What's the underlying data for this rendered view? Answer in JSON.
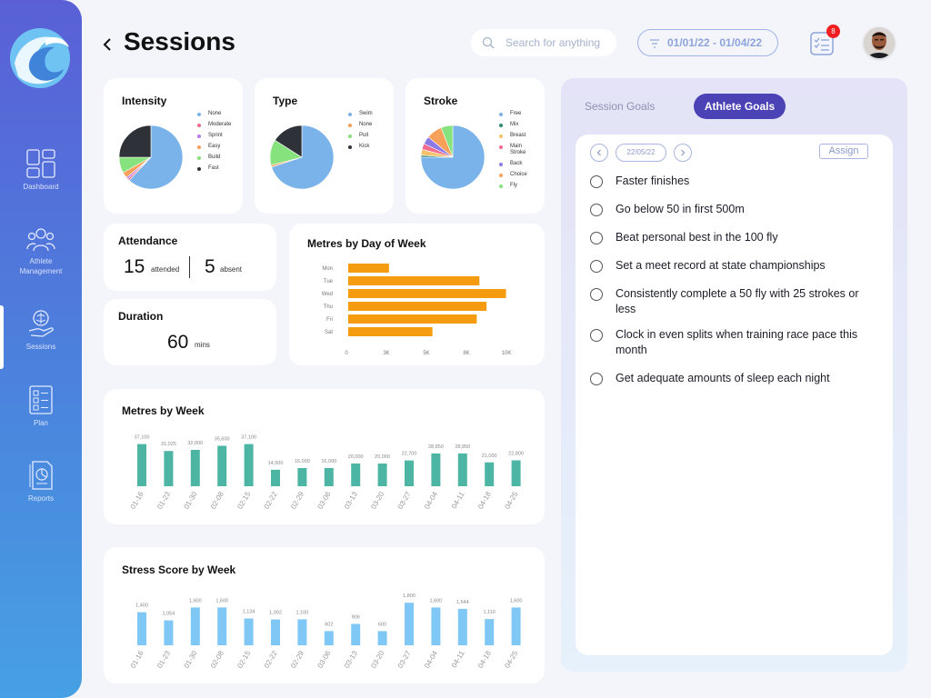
{
  "header": {
    "title": "Sessions",
    "search_placeholder": "Search for anything",
    "date_range": "01/01/22 - 01/04/22",
    "notification_count": "8"
  },
  "sidebar": {
    "items": [
      {
        "label": "Dashboard",
        "icon": "dashboard-icon"
      },
      {
        "label": "Athlete\nManagement",
        "icon": "athletes-icon"
      },
      {
        "label": "Sessions",
        "icon": "sessions-icon",
        "active": true
      },
      {
        "label": "Plan",
        "icon": "plan-icon"
      },
      {
        "label": "Reports",
        "icon": "reports-icon"
      }
    ]
  },
  "cards": {
    "intensity_title": "Intensity",
    "type_title": "Type",
    "stroke_title": "Stroke",
    "attendance_title": "Attendance",
    "attended_value": "15",
    "attended_label": "attended",
    "absent_value": "5",
    "absent_label": "absent",
    "duration_title": "Duration",
    "duration_value": "60",
    "duration_unit": "mins",
    "metres_day_title": "Metres by Day of Week",
    "metres_week_title": "Metres by Week",
    "stress_week_title": "Stress Score by Week"
  },
  "goals": {
    "tab_session": "Session Goals",
    "tab_athlete": "Athlete Goals",
    "date": "22/05/22",
    "assign_label": "Assign",
    "items": [
      "Faster finishes",
      "Go below 50 in first 500m",
      "Beat personal best in the 100 fly",
      "Set a meet record at state championships",
      "Consistently complete a 50 fly with 25 strokes or less",
      "Clock in even splits when training race pace this month",
      "Get adequate amounts of sleep each night"
    ]
  },
  "chart_data": [
    {
      "id": "intensity",
      "type": "pie",
      "title": "Intensity",
      "labels": [
        "None",
        "Moderate",
        "Sprint",
        "Easy",
        "Build",
        "Fast"
      ],
      "values": [
        62,
        1,
        1,
        3,
        8,
        25
      ],
      "colors": [
        "#7ab2ea",
        "#f06b8c",
        "#b57ae6",
        "#f6a05a",
        "#86e27c",
        "#2e3138"
      ]
    },
    {
      "id": "type",
      "type": "pie",
      "title": "Type",
      "labels": [
        "Swim",
        "None",
        "Pull",
        "Kick"
      ],
      "values": [
        70,
        1,
        13,
        16
      ],
      "colors": [
        "#7ab2ea",
        "#f6a05a",
        "#86e27c",
        "#2e3138"
      ]
    },
    {
      "id": "stroke",
      "type": "pie",
      "title": "Stroke",
      "labels": [
        "Free",
        "Mix",
        "Breast",
        "Main Stroke",
        "Back",
        "Choice",
        "Fly"
      ],
      "values": [
        75,
        1,
        3,
        3,
        4,
        8,
        6
      ],
      "colors": [
        "#7ab2ea",
        "#2e8b72",
        "#f5c26b",
        "#f06b8c",
        "#8c7ae6",
        "#f6a05a",
        "#86e27c"
      ]
    },
    {
      "id": "metres_day",
      "type": "bar",
      "orientation": "horizontal",
      "title": "Metres by Day of Week",
      "categories": [
        "Mon",
        "Tue",
        "Wed",
        "Thu",
        "Fri",
        "Sat"
      ],
      "values": [
        4600,
        14800,
        17800,
        15600,
        14500,
        9500
      ],
      "xticks": [
        "0",
        "3K",
        "5K",
        "8K",
        "10K"
      ],
      "xlim": [
        0,
        20000
      ],
      "color": "#f59b0f"
    },
    {
      "id": "metres_week",
      "type": "bar",
      "title": "Metres by Week",
      "categories": [
        "01-16",
        "01-23",
        "01-30",
        "02-08",
        "02-15",
        "02-22",
        "02-29",
        "03-06",
        "03-13",
        "03-20",
        "03-27",
        "04-04",
        "04-11",
        "04-18",
        "04-25"
      ],
      "values": [
        37100,
        31025,
        32000,
        35600,
        37100,
        14500,
        16000,
        16000,
        20000,
        20000,
        22700,
        28850,
        28850,
        21000,
        22800
      ],
      "labels": [
        "37,100",
        "31,025",
        "32,000",
        "35,600",
        "37,100",
        "14,500",
        "16,000",
        "16,000",
        "20,000",
        "20,000",
        "22,700",
        "28,850",
        "28,850",
        "21,000",
        "22,800"
      ],
      "ylim": [
        0,
        40000
      ],
      "color": "#4db5a4"
    },
    {
      "id": "stress_week",
      "type": "bar",
      "title": "Stress Score by Week",
      "categories": [
        "01-16",
        "01-23",
        "01-30",
        "02-08",
        "02-15",
        "02-22",
        "02-29",
        "03-06",
        "03-13",
        "03-20",
        "03-27",
        "04-04",
        "04-11",
        "04-18",
        "04-25"
      ],
      "values": [
        1400,
        1054,
        1600,
        1600,
        1134,
        1092,
        1100,
        602,
        906,
        600,
        1800,
        1600,
        1544,
        1110,
        1600
      ],
      "labels": [
        "1,400",
        "1,054",
        "1,600",
        "1,600",
        "1,134",
        "1,092",
        "1,100",
        "602",
        "906",
        "600",
        "1,800",
        "1,600",
        "1,544",
        "1,110",
        "1,600"
      ],
      "ylim": [
        0,
        2000
      ],
      "color": "#7fc7f5"
    }
  ]
}
